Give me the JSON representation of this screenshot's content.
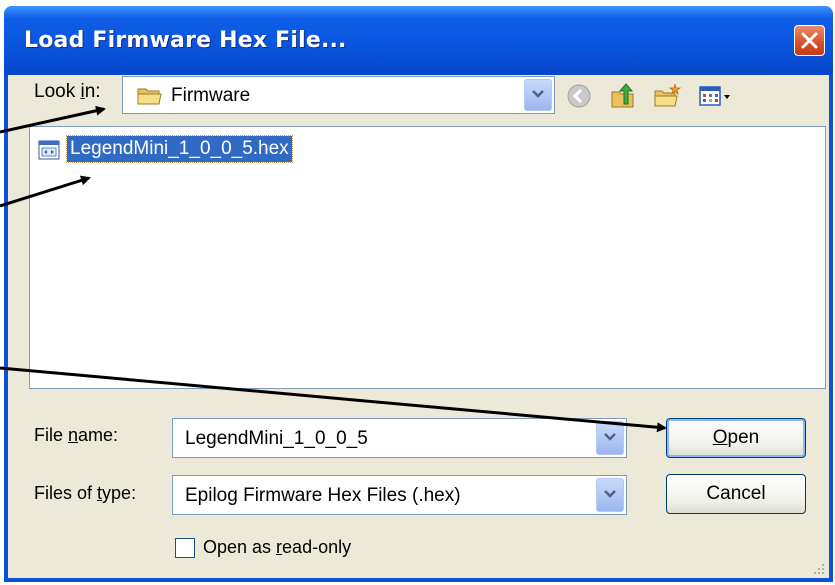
{
  "window": {
    "title": "Load Firmware Hex File...",
    "close_icon": "close-icon"
  },
  "look_in": {
    "label_pre": "Look ",
    "label_underlined": "i",
    "label_post": "n:",
    "value": "Firmware",
    "icon": "folder-icon"
  },
  "toolbar": {
    "icons": [
      "back-icon",
      "up-one-level-icon",
      "new-folder-icon",
      "views-menu-icon"
    ]
  },
  "files": [
    {
      "name": "LegendMini_1_0_0_5.hex",
      "icon": "hex-file-icon",
      "selected": true
    }
  ],
  "file_name": {
    "label_pre": "File ",
    "label_underlined": "n",
    "label_post": "ame:",
    "value": "LegendMini_1_0_0_5"
  },
  "file_type": {
    "label_pre": "Files of ",
    "label_underlined": "t",
    "label_post": "ype:",
    "value": "Epilog Firmware Hex Files (.hex)"
  },
  "buttons": {
    "open_underlined": "O",
    "open_rest": "pen",
    "cancel": "Cancel"
  },
  "readonly": {
    "label_pre": "Open as ",
    "label_underlined": "r",
    "label_post": "ead-only",
    "checked": false
  },
  "colors": {
    "titlebar": "#0a55df",
    "selection": "#316ac5",
    "dialog_face": "#ece9d8",
    "close_button": "#d5502b"
  }
}
